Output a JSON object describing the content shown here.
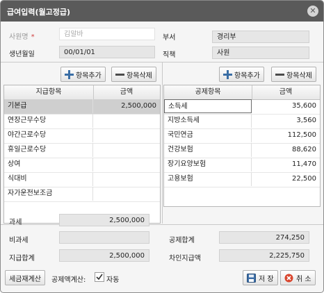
{
  "window": {
    "title": "급여입력(월고정급)"
  },
  "form": {
    "employee_name_label": "사원명",
    "required_mark": "*",
    "employee_name_value": "김알바",
    "department_label": "부서",
    "department_value": "경리부",
    "birthdate_label": "생년월일",
    "birthdate_value": "00/01/01",
    "position_label": "직책",
    "position_value": "사원"
  },
  "payments": {
    "add_label": "항목추가",
    "delete_label": "항목삭제",
    "headers": [
      "지급항목",
      "금액"
    ],
    "rows": [
      {
        "item": "기본급",
        "amount": "2,500,000"
      },
      {
        "item": "연장근무수당",
        "amount": ""
      },
      {
        "item": "야간근로수당",
        "amount": ""
      },
      {
        "item": "휴일근로수당",
        "amount": ""
      },
      {
        "item": "상여",
        "amount": ""
      },
      {
        "item": "식대비",
        "amount": ""
      },
      {
        "item": "자가운전보조금",
        "amount": ""
      }
    ]
  },
  "deductions": {
    "add_label": "항목추가",
    "delete_label": "항목삭제",
    "headers": [
      "공제항목",
      "금액"
    ],
    "rows": [
      {
        "item": "소득세",
        "amount": "35,600"
      },
      {
        "item": "지방소득세",
        "amount": "3,560"
      },
      {
        "item": "국민연금",
        "amount": "112,500"
      },
      {
        "item": "건강보험",
        "amount": "88,620"
      },
      {
        "item": "장기요양보험",
        "amount": "11,470"
      },
      {
        "item": "고용보험",
        "amount": "22,500"
      }
    ]
  },
  "summary": {
    "taxable_label": "과세",
    "taxable_value": "2,500,000",
    "nontaxable_label": "비과세",
    "nontaxable_value": "",
    "total_pay_label": "지급합계",
    "total_pay_value": "2,500,000",
    "total_deduction_label": "공제합계",
    "total_deduction_value": "274,250",
    "net_pay_label": "차인지급액",
    "net_pay_value": "2,225,750"
  },
  "footer": {
    "recalc_label": "세금재계산",
    "deduction_calc_label": "공제액계산:",
    "auto_label": "자동",
    "auto_checked": true,
    "save_label": "저 장",
    "cancel_label": "취 소"
  }
}
